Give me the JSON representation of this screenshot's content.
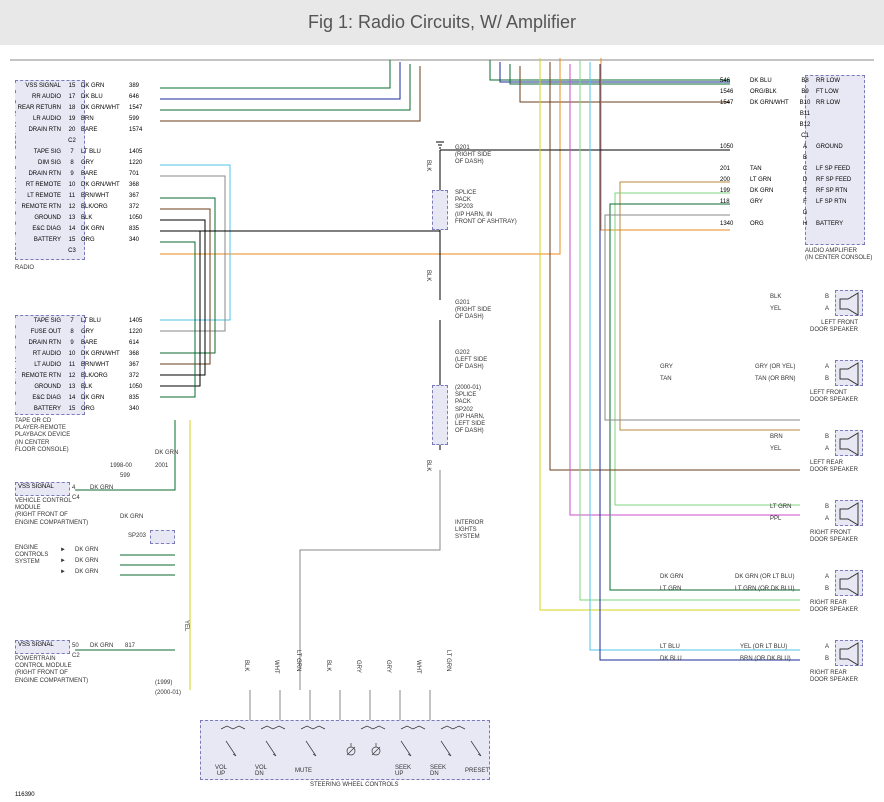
{
  "title": "Fig 1: Radio Circuits, W/ Amplifier",
  "radio": {
    "caption": "RADIO",
    "pins": [
      {
        "name": "VSS SIGNAL",
        "num": "15",
        "color": "DK GRN",
        "code": "389"
      },
      {
        "name": "RR AUDIO",
        "num": "17",
        "color": "DK BLU",
        "code": "646"
      },
      {
        "name": "REAR RETURN",
        "num": "18",
        "color": "DK GRN/WHT",
        "code": "1547"
      },
      {
        "name": "LR AUDIO",
        "num": "19",
        "color": "BRN",
        "code": "599"
      },
      {
        "name": "DRAIN RTN",
        "num": "20",
        "color": "BARE",
        "code": "1574"
      },
      {
        "name": "",
        "num": "C2",
        "color": "",
        "code": ""
      },
      {
        "name": "TAPE SIG",
        "num": "7",
        "color": "LT BLU",
        "code": "1405"
      },
      {
        "name": "DIM SIG",
        "num": "8",
        "color": "GRY",
        "code": "1220"
      },
      {
        "name": "DRAIN RTN",
        "num": "9",
        "color": "BARE",
        "code": "701"
      },
      {
        "name": "RT REMOTE",
        "num": "10",
        "color": "DK GRN/WHT",
        "code": "368"
      },
      {
        "name": "LT REMOTE",
        "num": "11",
        "color": "BRN/WHT",
        "code": "367"
      },
      {
        "name": "REMOTE RTN",
        "num": "12",
        "color": "BLK/ORG",
        "code": "372"
      },
      {
        "name": "GROUND",
        "num": "13",
        "color": "BLK",
        "code": "1050"
      },
      {
        "name": "E&C DIAG",
        "num": "14",
        "color": "DK GRN",
        "code": "835"
      },
      {
        "name": "BATTERY",
        "num": "15",
        "color": "ORG",
        "code": "340"
      },
      {
        "name": "",
        "num": "C3",
        "color": "",
        "code": ""
      }
    ]
  },
  "tapecd": {
    "caption": "TAPE OR CD\nPLAYER-REMOTE\nPLAYBACK DEVICE\n(IN CENTER\nFLOOR CONSOLE)",
    "pins": [
      {
        "name": "TAPE SIG",
        "num": "7",
        "color": "LT BLU",
        "code": "1405"
      },
      {
        "name": "FUSE OUT",
        "num": "8",
        "color": "GRY",
        "code": "1220"
      },
      {
        "name": "DRAIN RTN",
        "num": "9",
        "color": "BARE",
        "code": "614"
      },
      {
        "name": "RT AUDIO",
        "num": "10",
        "color": "DK GRN/WHT",
        "code": "368"
      },
      {
        "name": "LT AUDIO",
        "num": "11",
        "color": "BRN/WHT",
        "code": "367"
      },
      {
        "name": "REMOTE RTN",
        "num": "12",
        "color": "BLK/ORG",
        "code": "372"
      },
      {
        "name": "GROUND",
        "num": "13",
        "color": "BLK",
        "code": "1050"
      },
      {
        "name": "E&C DIAG",
        "num": "14",
        "color": "DK GRN",
        "code": "835"
      },
      {
        "name": "BATTERY",
        "num": "15",
        "color": "ORG",
        "code": "340"
      }
    ]
  },
  "amp": {
    "caption": "AUDIO AMPLIFIER\n(IN CENTER CONSOLE)",
    "pins_upper": [
      {
        "name": "RR LOW",
        "num": "B8",
        "color": "DK BLU",
        "code": "546"
      },
      {
        "name": "FT LOW",
        "num": "B9",
        "color": "ORG/BLK",
        "code": "1546"
      },
      {
        "name": "RR LOW",
        "num": "B10",
        "color": "DK GRN/WHT",
        "code": "1547"
      },
      {
        "name": "",
        "num": "B11",
        "color": "",
        "code": ""
      },
      {
        "name": "",
        "num": "B12",
        "color": "",
        "code": ""
      },
      {
        "name": "",
        "num": "C1",
        "color": "",
        "code": ""
      }
    ],
    "pins_lower": [
      {
        "name": "GROUND",
        "num": "A",
        "color": "",
        "code": "1050"
      },
      {
        "name": "",
        "num": "B",
        "color": "",
        "code": ""
      },
      {
        "name": "LF SP FEED",
        "num": "C",
        "color": "TAN",
        "code": "201"
      },
      {
        "name": "RF SP FEED",
        "num": "D",
        "color": "LT GRN",
        "code": "200"
      },
      {
        "name": "RF SP RTN",
        "num": "E",
        "color": "DK GRN",
        "code": "199"
      },
      {
        "name": "LF SP RTN",
        "num": "F",
        "color": "GRY",
        "code": "118"
      },
      {
        "name": "",
        "num": "G",
        "color": "",
        "code": ""
      },
      {
        "name": "BATTERY",
        "num": "H",
        "color": "ORG",
        "code": "1340"
      }
    ]
  },
  "vss1": {
    "label": "VSS SIGNAL",
    "num": "4",
    "caption": "VEHICLE CONTROL\nMODULE\n(RIGHT FRONT OF\nENGINE COMPARTMENT)",
    "pin": "C4",
    "color": "DK GRN"
  },
  "vss2": {
    "label": "VSS SIGNAL",
    "num": "50",
    "caption": "POWERTRAIN\nCONTROL MODULE\n(RIGHT FRONT OF\nENGINE COMPARTMENT)",
    "pin": "C2",
    "color": "DK GRN",
    "code": "817"
  },
  "engine": {
    "caption": "ENGINE\nCONTROLS\nSYSTEM",
    "colors": [
      "DK GRN",
      "DK GRN",
      "DK GRN"
    ]
  },
  "splice1": {
    "caption": "SPLICE\nPACK\nSP203\n(I/P HARN, IN\nFRONT OF ASHTRAY)"
  },
  "splice2": {
    "caption": "(2000-01)\nSPLICE\nPACK\nSP202\n(I/P HARN,\nLEFT SIDE\nOF DASH)"
  },
  "g201": {
    "label": "G201\n(RIGHT SIDE\nOF DASH)"
  },
  "g202": {
    "label": "G202\n(LEFT SIDE\nOF DASH)"
  },
  "sp203": {
    "label": "SP203"
  },
  "interior": {
    "caption": "INTERIOR\nLIGHTS\nSYSTEM"
  },
  "years": {
    "y1": "1998-00",
    "y2": "2001",
    "y3": "(1999)",
    "y4": "(2000-01)"
  },
  "steering": {
    "caption": "STEERING WHEEL CONTROLS",
    "buttons": [
      "VOL\nUP",
      "VOL\nDN",
      "MUTE",
      "SEEK\nUP",
      "SEEK\nDN",
      "PRESET"
    ]
  },
  "speakers": [
    {
      "caption": "LEFT FRONT\nDOOR SPEAKER",
      "wires": [
        {
          "c": "BLK",
          "n": "B"
        },
        {
          "c": "YEL",
          "n": "A"
        }
      ]
    },
    {
      "caption": "LEFT FRONT\nDOOR SPEAKER",
      "wires": [
        {
          "c": "GRY (OR YEL)",
          "n": "A",
          "left": "GRY"
        },
        {
          "c": "TAN (OR BRN)",
          "n": "B",
          "left": "TAN"
        }
      ]
    },
    {
      "caption": "LEFT REAR\nDOOR SPEAKER",
      "wires": [
        {
          "c": "BRN",
          "n": "B"
        },
        {
          "c": "YEL",
          "n": "A"
        }
      ]
    },
    {
      "caption": "RIGHT FRONT\nDOOR SPEAKER",
      "wires": [
        {
          "c": "LT GRN",
          "n": "B"
        },
        {
          "c": "PPL",
          "n": "A"
        }
      ]
    },
    {
      "caption": "RIGHT REAR\nDOOR SPEAKER",
      "wires": [
        {
          "c": "DK GRN (OR LT BLU)",
          "n": "A",
          "left": "DK GRN"
        },
        {
          "c": "LT GRN (OR DK BLU)",
          "n": "B",
          "left": "LT GRN"
        }
      ]
    },
    {
      "caption": "RIGHT REAR\nDOOR SPEAKER",
      "wires": [
        {
          "c": "YEL (OR LT BLU)",
          "n": "A",
          "left": "LT BLU"
        },
        {
          "c": "BRN (OR DK BLU)",
          "n": "B",
          "left": "DK BLU"
        }
      ]
    }
  ],
  "wire_labels": {
    "blk": "BLK",
    "gry": "GRY",
    "yel": "YEL",
    "wht": "WHT",
    "lt_grn": "LT GRN",
    "dk_grn": "DK GRN",
    "599": "599"
  },
  "footer_num": "116390"
}
